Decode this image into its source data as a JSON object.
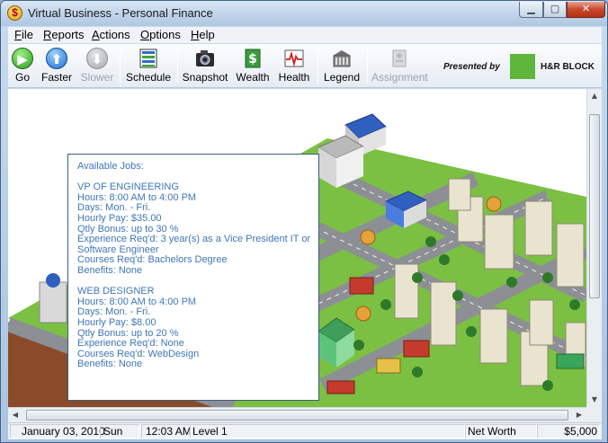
{
  "window": {
    "title": "Virtual Business - Personal Finance",
    "icon": "dollar-coin-icon",
    "controls": [
      "minimize",
      "maximize",
      "close"
    ]
  },
  "menubar": {
    "items": [
      {
        "label": "File",
        "mnemonic": "F",
        "rest": "ile"
      },
      {
        "label": "Reports",
        "mnemonic": "R",
        "rest": "eports"
      },
      {
        "label": "Actions",
        "mnemonic": "A",
        "rest": "ctions"
      },
      {
        "label": "Options",
        "mnemonic": "O",
        "rest": "ptions"
      },
      {
        "label": "Help",
        "mnemonic": "H",
        "rest": "elp"
      }
    ]
  },
  "toolbar": {
    "buttons": [
      {
        "label": "Go",
        "icon": "play-icon",
        "enabled": true
      },
      {
        "label": "Faster",
        "icon": "up-arrow-icon",
        "enabled": true
      },
      {
        "label": "Slower",
        "icon": "down-arrow-icon",
        "enabled": false
      },
      {
        "label": "Schedule",
        "icon": "schedule-icon",
        "enabled": true
      },
      {
        "label": "Snapshot",
        "icon": "camera-icon",
        "enabled": true
      },
      {
        "label": "Wealth",
        "icon": "dollar-doc-icon",
        "enabled": true
      },
      {
        "label": "Health",
        "icon": "heart-monitor-icon",
        "enabled": true
      },
      {
        "label": "Legend",
        "icon": "building-icon",
        "enabled": true
      },
      {
        "label": "Assignment",
        "icon": "assignment-icon",
        "enabled": false
      }
    ],
    "sponsor": {
      "presented_label": "Presented by",
      "name": "H&R BLOCK",
      "brand_color": "#5eb63a"
    }
  },
  "jobs_panel": {
    "heading": "Available Jobs:",
    "jobs": [
      {
        "title": "VP OF ENGINEERING",
        "hours": "Hours: 8:00 AM to 4:00 PM",
        "days": "Days: Mon. - Fri.",
        "pay": "Hourly Pay: $35.00",
        "bonus": "Qtly Bonus: up to 30 %",
        "experience_line1": "Experience Req'd: 3 year(s) as a Vice President IT or",
        "experience_line2": "Software Engineer",
        "courses": "Courses Req'd: Bachelors Degree",
        "benefits": "Benefits: None"
      },
      {
        "title": "WEB DESIGNER",
        "hours": "Hours: 8:00 AM to 4:00 PM",
        "days": "Days: Mon. - Fri.",
        "pay": "Hourly Pay: $8.00",
        "bonus": "Qtly Bonus: up to 20 %",
        "experience_line1": "Experience Req'd: None",
        "courses": "Courses Req'd: WebDesign",
        "benefits": "Benefits: None"
      }
    ],
    "text_color": "#3f76b8"
  },
  "statusbar": {
    "date": "January 03, 2010",
    "day": "Sun",
    "time": "12:03 AM",
    "level": "Level 1",
    "net_worth_label": "Net Worth",
    "net_worth_value": "$5,000"
  },
  "colors": {
    "grass": "#7bc043",
    "road": "#8c8f94",
    "dirt": "#8a4b2a",
    "accent_blue": "#2f5fbf"
  }
}
